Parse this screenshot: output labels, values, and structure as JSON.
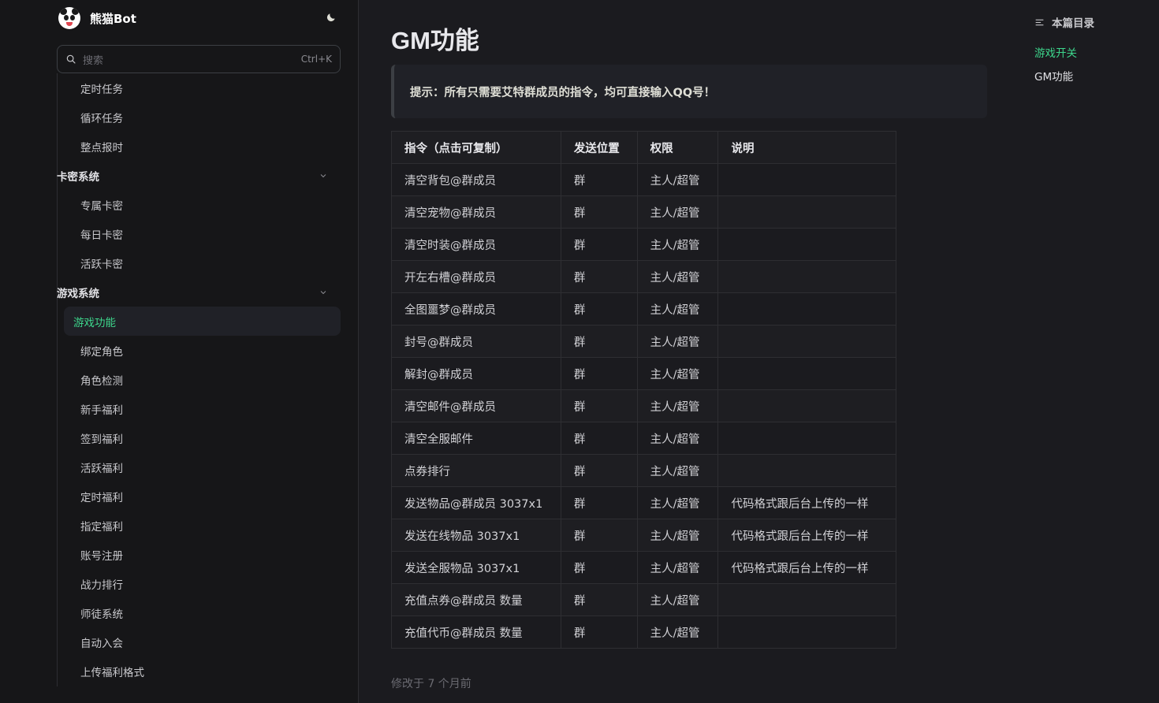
{
  "brand": {
    "title": "熊猫Bot"
  },
  "search": {
    "placeholder": "搜索",
    "shortcut": "Ctrl+K"
  },
  "sidebar": {
    "items_top": [
      "定时任务",
      "循环任务",
      "整点报时"
    ],
    "group_card": {
      "label": "卡密系统",
      "items": [
        "专属卡密",
        "每日卡密",
        "活跃卡密"
      ]
    },
    "group_game": {
      "label": "游戏系统",
      "items": [
        "游戏功能",
        "绑定角色",
        "角色检测",
        "新手福利",
        "签到福利",
        "活跃福利",
        "定时福利",
        "指定福利",
        "账号注册",
        "战力排行",
        "师徒系统",
        "自动入会",
        "上传福利格式"
      ],
      "active_index": 0
    }
  },
  "page": {
    "title": "GM功能",
    "tip": "提示：所有只需要艾特群成员的指令，均可直接输入QQ号！",
    "modified": "修改于 7 个月前"
  },
  "table": {
    "headers": [
      "指令（点击可复制）",
      "发送位置",
      "权限",
      "说明"
    ],
    "rows": [
      [
        "清空背包@群成员",
        "群",
        "主人/超管",
        ""
      ],
      [
        "清空宠物@群成员",
        "群",
        "主人/超管",
        ""
      ],
      [
        "清空时装@群成员",
        "群",
        "主人/超管",
        ""
      ],
      [
        "开左右槽@群成员",
        "群",
        "主人/超管",
        ""
      ],
      [
        "全图噩梦@群成员",
        "群",
        "主人/超管",
        ""
      ],
      [
        "封号@群成员",
        "群",
        "主人/超管",
        ""
      ],
      [
        "解封@群成员",
        "群",
        "主人/超管",
        ""
      ],
      [
        "清空邮件@群成员",
        "群",
        "主人/超管",
        ""
      ],
      [
        "清空全服邮件",
        "群",
        "主人/超管",
        ""
      ],
      [
        "点券排行",
        "群",
        "主人/超管",
        ""
      ],
      [
        "发送物品@群成员 3037x1",
        "群",
        "主人/超管",
        "代码格式跟后台上传的一样"
      ],
      [
        "发送在线物品 3037x1",
        "群",
        "主人/超管",
        "代码格式跟后台上传的一样"
      ],
      [
        "发送全服物品 3037x1",
        "群",
        "主人/超管",
        "代码格式跟后台上传的一样"
      ],
      [
        "充值点券@群成员 数量",
        "群",
        "主人/超管",
        ""
      ],
      [
        "充值代币@群成员 数量",
        "群",
        "主人/超管",
        ""
      ]
    ]
  },
  "toc": {
    "title": "本篇目录",
    "links": [
      "游戏开关",
      "GM功能"
    ]
  },
  "colors": {
    "accent": "#3dd68c",
    "background": "#1b1b1f",
    "sidebar": "#161618"
  }
}
